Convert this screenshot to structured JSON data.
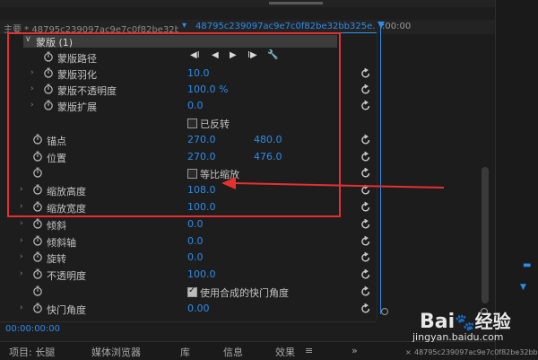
{
  "header": {
    "source_clip": "主要 * 48795c239097ac9e7c0f82be32bb...",
    "arrow": "▾",
    "active_clip": "48795c239097ac9e7c0f82be32bb325e...",
    "timecode": ":00:00"
  },
  "mask": {
    "title": "蒙版 (1)",
    "path_label": "蒙版路径",
    "feather_label": "蒙版羽化",
    "feather_value": "10.0",
    "opacity_label": "蒙版不透明度",
    "opacity_value": "100.0 %",
    "expansion_label": "蒙版扩展",
    "expansion_value": "0.0",
    "inverted_label": "已反转",
    "controls": {
      "prev": "◀I",
      "back": "◀",
      "fwd": "▶",
      "next": "I▶",
      "wrench": "🔧"
    }
  },
  "motion": {
    "anchor_label": "锚点",
    "anchor_x": "270.0",
    "anchor_y": "480.0",
    "position_label": "位置",
    "position_x": "270.0",
    "position_y": "476.0",
    "uniform_label": "等比缩放",
    "scale_h_label": "缩放高度",
    "scale_h_value": "108.0",
    "scale_w_label": "缩放宽度",
    "scale_w_value": "100.0",
    "skew_label": "倾斜",
    "skew_value": "0.0",
    "skew_axis_label": "倾斜轴",
    "skew_axis_value": "0.0",
    "rotation_label": "旋转",
    "rotation_value": "0.0",
    "opacity_label": "不透明度",
    "opacity_value": "100.0",
    "comp_shutter_label": "使用合成的快门角度",
    "shutter_label": "快门角度",
    "shutter_value": "0.00"
  },
  "status": {
    "timecode": "00:00:00:00"
  },
  "tabs": [
    "项目: 长腿",
    "媒体浏览器",
    "库",
    "信息",
    "效果",
    "≡",
    "»"
  ],
  "watermark": {
    "bai": "Bai",
    "paw": "🐾",
    "du": "经验",
    "url": "jingyan.baidu.com"
  },
  "footer": {
    "close": "×",
    "clip": "48795c239097ac9e7c0f82be32bb325e..."
  },
  "colors": {
    "accent": "#2d8ceb",
    "highlight": "#e53030",
    "panel": "#1d1d1d"
  }
}
